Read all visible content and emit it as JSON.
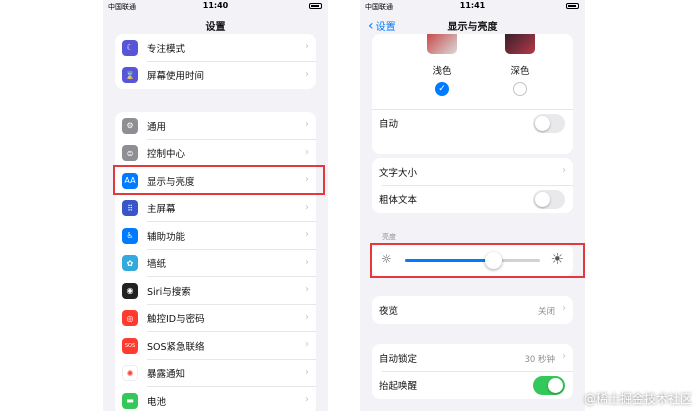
{
  "left": {
    "status": {
      "carrier": "中国联通",
      "time": "11:40"
    },
    "title": "设置",
    "group1": [
      {
        "label": "专注模式",
        "icon": "moon-icon",
        "color": "#5856d6",
        "glyph": "☾"
      },
      {
        "label": "屏幕使用时间",
        "icon": "hourglass-icon",
        "color": "#5856d6",
        "glyph": "⌛"
      }
    ],
    "group2": [
      {
        "label": "通用",
        "icon": "gear-icon",
        "color": "#8e8e93",
        "glyph": "⚙"
      },
      {
        "label": "控制中心",
        "icon": "toggles-icon",
        "color": "#8e8e93",
        "glyph": "⊜"
      },
      {
        "label": "显示与亮度",
        "icon": "text-size-icon",
        "color": "#007aff",
        "glyph": "AA"
      },
      {
        "label": "主屏幕",
        "icon": "home-grid-icon",
        "color": "#3a55c9",
        "glyph": "⠿"
      },
      {
        "label": "辅助功能",
        "icon": "accessibility-icon",
        "color": "#007aff",
        "glyph": "♿"
      },
      {
        "label": "墙纸",
        "icon": "wallpaper-flower-icon",
        "color": "#34aadc",
        "glyph": "✿"
      },
      {
        "label": "Siri与搜索",
        "icon": "siri-icon",
        "color": "#222222",
        "glyph": "◉"
      },
      {
        "label": "触控ID与密码",
        "icon": "fingerprint-icon",
        "color": "#ff3b30",
        "glyph": "◎"
      },
      {
        "label": "SOS紧急联络",
        "icon": "sos-icon",
        "color": "#ff3b30",
        "glyph": "SOS"
      },
      {
        "label": "暴露通知",
        "icon": "exposure-icon",
        "color": "#ffffff",
        "glyph": "✺"
      },
      {
        "label": "电池",
        "icon": "battery-icon",
        "color": "#34c759",
        "glyph": "▬"
      }
    ]
  },
  "right": {
    "status": {
      "carrier": "中国联通",
      "time": "11:41"
    },
    "back_label": "设置",
    "title": "显示与亮度",
    "appearance": {
      "light_label": "浅色",
      "dark_label": "深色",
      "selected": "light"
    },
    "auto_label": "自动",
    "auto_on": false,
    "text_size_label": "文字大小",
    "bold_text_label": "粗体文本",
    "bold_on": false,
    "brightness_header": "亮度",
    "brightness_level": 0.65,
    "night_shift_label": "夜览",
    "night_shift_value": "关闭",
    "auto_lock_label": "自动锁定",
    "auto_lock_value": "30 秒钟",
    "raise_to_wake_label": "抬起唤醒",
    "raise_on": true
  },
  "watermark": "@稀土掘金技术社区",
  "colors": {
    "accent": "#007aff",
    "highlight": "#e4393c",
    "toggle_on": "#34c759"
  }
}
